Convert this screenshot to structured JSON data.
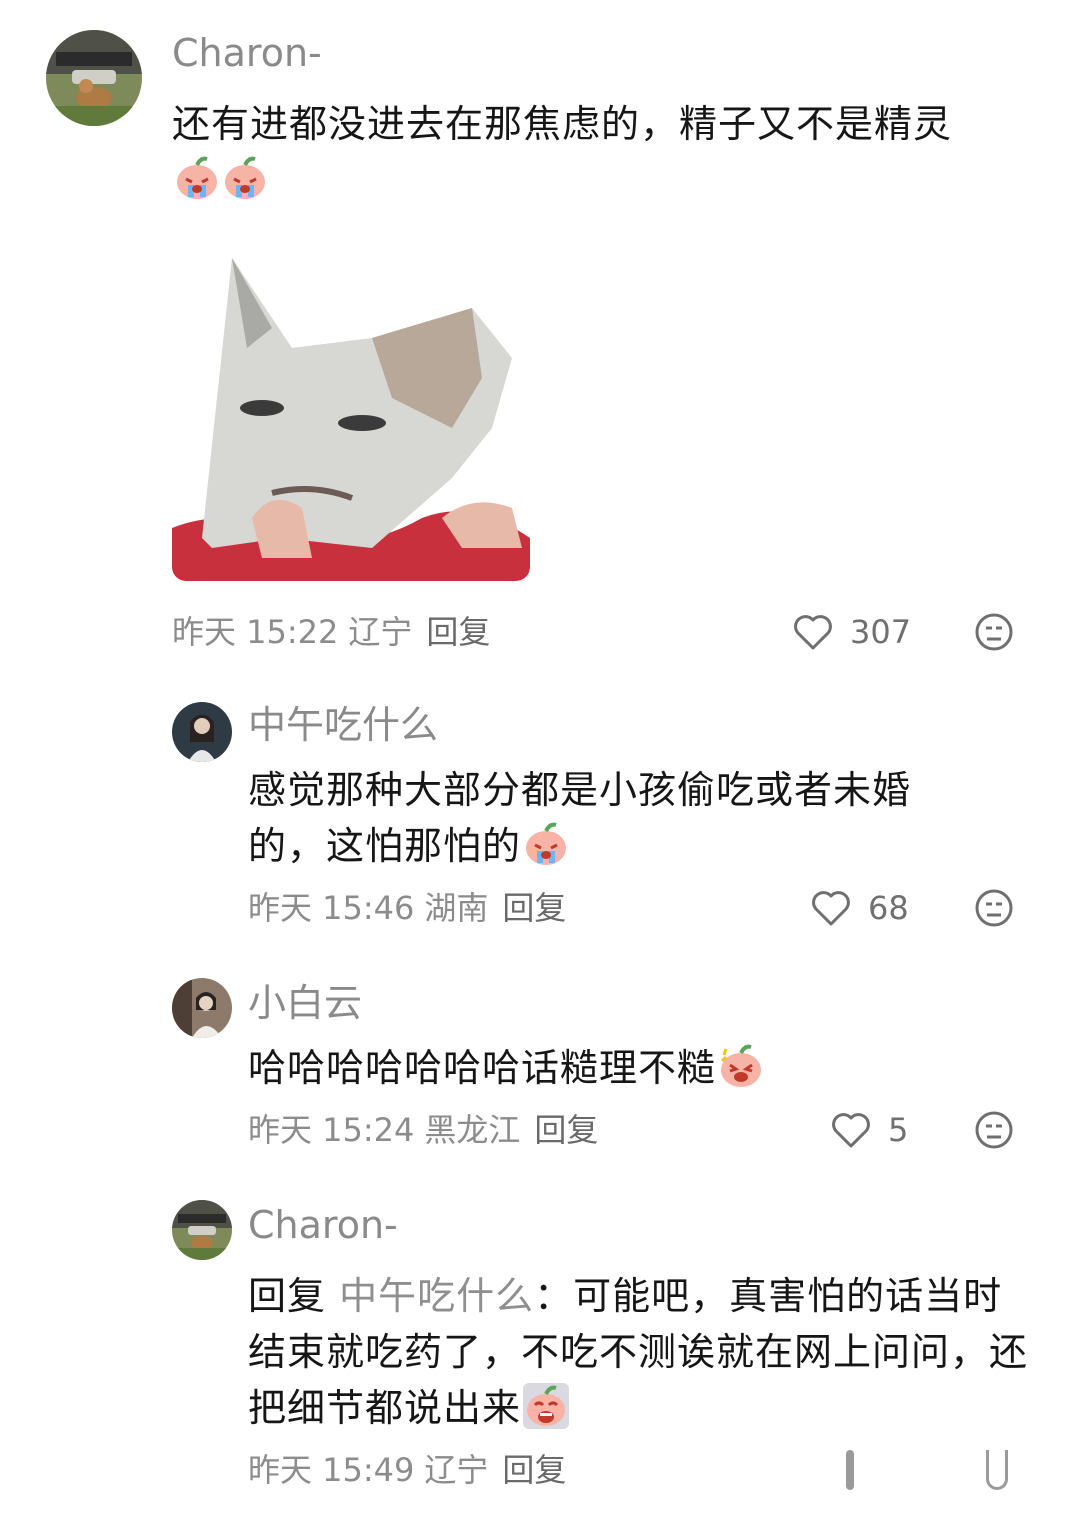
{
  "comments": [
    {
      "username": "Charon-",
      "text": "还有进都没进去在那焦虑的，精子又不是精灵",
      "time": "昨天 15:22",
      "location": "辽宁",
      "reply_label": "回复",
      "likes": "307",
      "emoji": "crying-peach-emoji",
      "has_image": true
    },
    {
      "username": "中午吃什么",
      "text": "感觉那种大部分都是小孩偷吃或者未婚的，这怕那怕的",
      "time": "昨天 15:46",
      "location": "湖南",
      "reply_label": "回复",
      "likes": "68",
      "emoji": "crying-peach-emoji"
    },
    {
      "username": "小白云",
      "text": "哈哈哈哈哈哈哈话糙理不糙",
      "time": "昨天 15:24",
      "location": "黑龙江",
      "reply_label": "回复",
      "likes": "5",
      "emoji": "laughing-peach-emoji"
    },
    {
      "username": "Charon-",
      "reply_prefix": "回复",
      "mention": "中午吃什么",
      "colon": "：",
      "text": "可能吧，真害怕的话当时结束就吃药了，不吃不测诶就在网上问问，还把细节都说出来",
      "time": "昨天 15:49",
      "location": "辽宁",
      "reply_label": "回复",
      "emoji": "sobbing-peach-emoji"
    }
  ],
  "colors": {
    "text": "#161616",
    "username": "#8a8a8a",
    "meta": "#8c8c8c",
    "icon": "#6f6f6f"
  }
}
